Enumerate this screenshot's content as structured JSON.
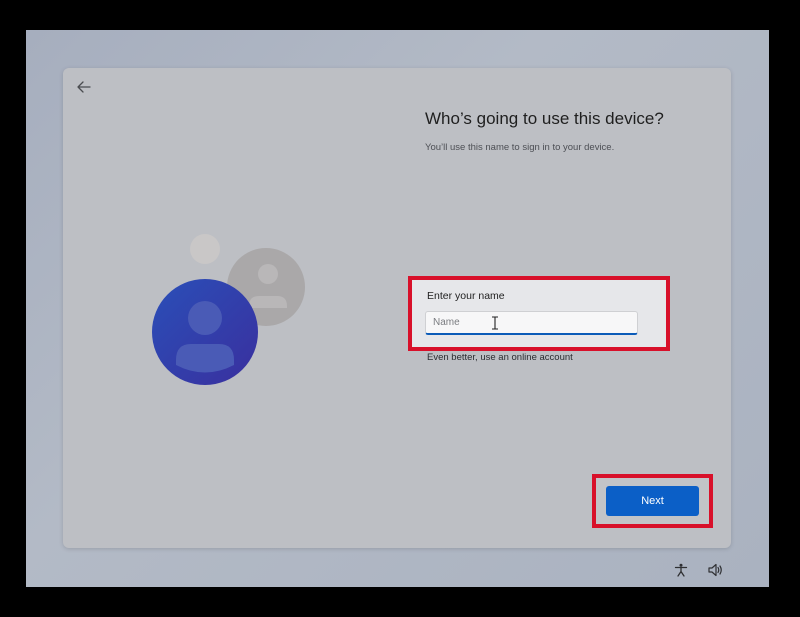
{
  "setup": {
    "heading": "Who’s going to use this device?",
    "subtitle": "You’ll use this name to sign in to your device.",
    "name_label": "Enter your name",
    "name_value": "",
    "name_placeholder": "Name",
    "online_account_link": "Even better, use an online account",
    "next_label": "Next"
  },
  "icons": {
    "back": "back-arrow-icon",
    "accessibility": "accessibility-icon",
    "volume": "volume-icon",
    "avatar": "user-avatar-illustration"
  },
  "colors": {
    "accent": "#0b5fc7",
    "highlight": "#d8102a",
    "avatar_primary": "#2e3fae",
    "avatar_secondary": "#a9a7a8"
  }
}
